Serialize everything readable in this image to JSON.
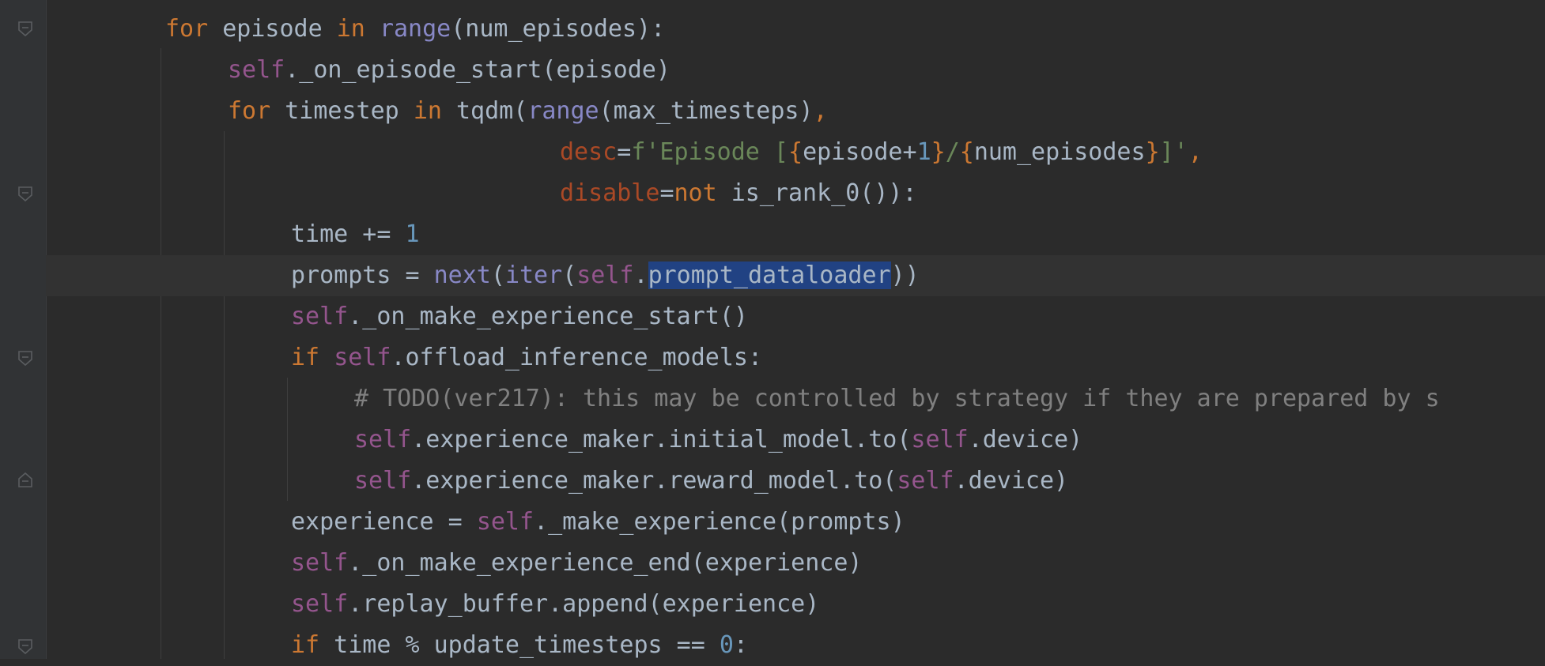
{
  "editor": {
    "lines": [
      [
        {
          "t": "for",
          "c": "kw"
        },
        {
          "t": " episode "
        },
        {
          "t": "in",
          "c": "kw"
        },
        {
          "t": " "
        },
        {
          "t": "range",
          "c": "builtin"
        },
        {
          "t": "(num_episodes):"
        }
      ],
      [
        {
          "t": "self",
          "c": "self"
        },
        {
          "t": "._on_episode_start(episode)"
        }
      ],
      [
        {
          "t": "for",
          "c": "kw"
        },
        {
          "t": " timestep "
        },
        {
          "t": "in",
          "c": "kw"
        },
        {
          "t": " tqdm("
        },
        {
          "t": "range",
          "c": "builtin"
        },
        {
          "t": "(max_timesteps)"
        },
        {
          "t": ",",
          "c": "kw"
        }
      ],
      [
        {
          "t": "desc",
          "c": "param"
        },
        {
          "t": "="
        },
        {
          "t": "f'Episode [",
          "c": "str"
        },
        {
          "t": "{",
          "c": "kw"
        },
        {
          "t": "episode+"
        },
        {
          "t": "1",
          "c": "num"
        },
        {
          "t": "}",
          "c": "kw"
        },
        {
          "t": "/",
          "c": "str"
        },
        {
          "t": "{",
          "c": "kw"
        },
        {
          "t": "num_episodes"
        },
        {
          "t": "}",
          "c": "kw"
        },
        {
          "t": "]'",
          "c": "str"
        },
        {
          "t": ",",
          "c": "kw"
        }
      ],
      [
        {
          "t": "disable",
          "c": "param"
        },
        {
          "t": "="
        },
        {
          "t": "not",
          "c": "kw"
        },
        {
          "t": " is_rank_0()):"
        }
      ],
      [
        {
          "t": "time += "
        },
        {
          "t": "1",
          "c": "num"
        }
      ],
      [
        {
          "t": "prompts = "
        },
        {
          "t": "next",
          "c": "builtin"
        },
        {
          "t": "("
        },
        {
          "t": "iter",
          "c": "builtin"
        },
        {
          "t": "("
        },
        {
          "t": "self",
          "c": "self"
        },
        {
          "t": "."
        },
        {
          "t": "prompt_dataloader",
          "c": "sel"
        },
        {
          "t": "))"
        }
      ],
      [
        {
          "t": "self",
          "c": "self"
        },
        {
          "t": "._on_make_experience_start()"
        }
      ],
      [
        {
          "t": "if",
          "c": "kw"
        },
        {
          "t": " "
        },
        {
          "t": "self",
          "c": "self"
        },
        {
          "t": ".offload_inference_models:"
        }
      ],
      [
        {
          "t": "# TODO(ver217): this may be controlled by strategy if they are prepared by s",
          "c": "comment"
        }
      ],
      [
        {
          "t": "self",
          "c": "self"
        },
        {
          "t": ".experience_maker.initial_model.to("
        },
        {
          "t": "self",
          "c": "self"
        },
        {
          "t": ".device)"
        }
      ],
      [
        {
          "t": "self",
          "c": "self"
        },
        {
          "t": ".experience_maker.reward_model.to("
        },
        {
          "t": "self",
          "c": "self"
        },
        {
          "t": ".device)"
        }
      ],
      [
        {
          "t": "experience = "
        },
        {
          "t": "self",
          "c": "self"
        },
        {
          "t": "._make_experience(prompts)"
        }
      ],
      [
        {
          "t": "self",
          "c": "self"
        },
        {
          "t": "._on_make_experience_end(experience)"
        }
      ],
      [
        {
          "t": "self",
          "c": "self"
        },
        {
          "t": ".replay_buffer.append(experience)"
        }
      ],
      [
        {
          "t": "if",
          "c": "kw"
        },
        {
          "t": " time % update_timesteps == "
        },
        {
          "t": "0",
          "c": "num"
        },
        {
          "t": ":"
        }
      ]
    ],
    "selected_text": "prompt_dataloader",
    "colors": {
      "background": "#2b2b2b",
      "current_line": "#323232",
      "selection": "#214283",
      "keyword": "#cc7832",
      "builtin": "#8888c6",
      "self": "#94558d",
      "number": "#6897bb",
      "string": "#6a8759",
      "param": "#aa4926",
      "comment": "#808080",
      "text": "#a9b7c6"
    },
    "fold_icons": [
      "fold-start-icon",
      "fold-start-icon",
      "fold-start-icon",
      "fold-end-icon",
      "fold-start-icon"
    ]
  }
}
